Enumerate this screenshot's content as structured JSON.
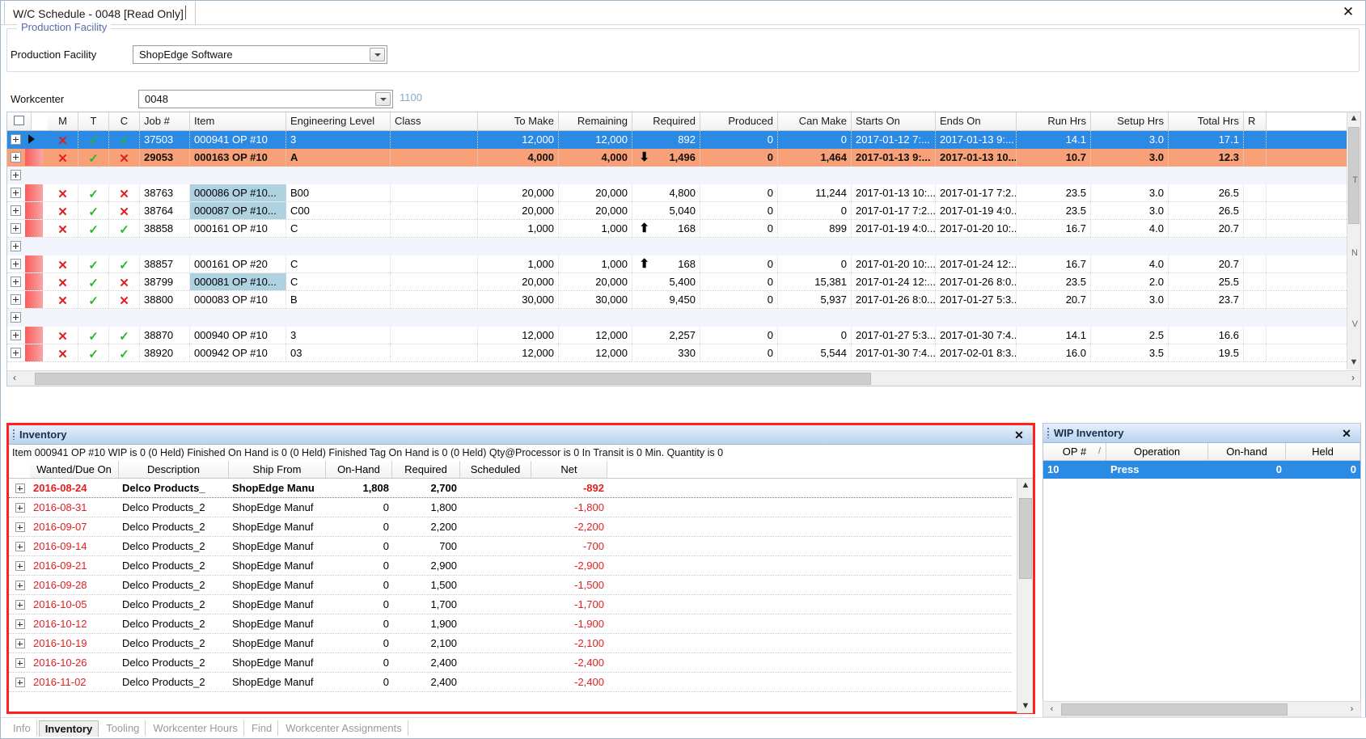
{
  "window": {
    "tab_title": "W/C Schedule - 0048 [Read Only]",
    "close_label": "✕"
  },
  "facility_group": {
    "legend": "Production Facility",
    "facility_label": "Production Facility",
    "facility_value": "ShopEdge Software",
    "workcenter_label": "Workcenter",
    "workcenter_value": "0048",
    "workcenter_code": "1100"
  },
  "schedule_grid": {
    "columns": [
      "M",
      "T",
      "C",
      "Job #",
      "Item",
      "Engineering Level",
      "Class",
      "To Make",
      "Remaining",
      "Required",
      "Produced",
      "Can Make",
      "Starts On",
      "Ends On",
      "Run Hrs",
      "Setup Hrs",
      "Total Hrs",
      "R"
    ],
    "rows": [
      {
        "state": "selected",
        "m": "✕",
        "t": "✓",
        "c": "✓",
        "job": "37503",
        "item": "000941 OP #10",
        "eng": "3",
        "class": "",
        "to_make": "12,000",
        "remaining": "12,000",
        "arrow": "",
        "required": "892",
        "produced": "0",
        "can_make": "0",
        "starts_on": "2017-01-12 7:...",
        "ends_on": "2017-01-13 9:...",
        "run_hrs": "14.1",
        "setup_hrs": "3.0",
        "total_hrs": "17.1"
      },
      {
        "state": "warn",
        "m": "✕",
        "t": "✓",
        "c": "✕",
        "job": "29053",
        "item": "000163 OP #10",
        "eng": "A",
        "class": "",
        "to_make": "4,000",
        "remaining": "4,000",
        "arrow": "down",
        "required": "1,496",
        "produced": "0",
        "can_make": "1,464",
        "starts_on": "2017-01-13 9:...",
        "ends_on": "2017-01-13 10...",
        "run_hrs": "10.7",
        "setup_hrs": "3.0",
        "total_hrs": "12.3"
      },
      {
        "state": "group"
      },
      {
        "state": "plain",
        "m": "✕",
        "t": "✓",
        "c": "✕",
        "job": "38763",
        "item": "000086 OP #10...",
        "item_hl": true,
        "eng": "B00",
        "class": "",
        "to_make": "20,000",
        "remaining": "20,000",
        "arrow": "",
        "required": "4,800",
        "produced": "0",
        "can_make": "11,244",
        "starts_on": "2017-01-13 10:...",
        "ends_on": "2017-01-17 7:2...",
        "run_hrs": "23.5",
        "setup_hrs": "3.0",
        "total_hrs": "26.5"
      },
      {
        "state": "plain",
        "m": "✕",
        "t": "✓",
        "c": "✕",
        "job": "38764",
        "item": "000087 OP #10...",
        "item_hl": true,
        "eng": "C00",
        "class": "",
        "to_make": "20,000",
        "remaining": "20,000",
        "arrow": "",
        "required": "5,040",
        "produced": "0",
        "can_make": "0",
        "starts_on": "2017-01-17 7:2...",
        "ends_on": "2017-01-19 4:0...",
        "run_hrs": "23.5",
        "setup_hrs": "3.0",
        "total_hrs": "26.5"
      },
      {
        "state": "plain",
        "m": "✕",
        "t": "✓",
        "c": "✓",
        "job": "38858",
        "item": "000161 OP #10",
        "eng": "C",
        "class": "",
        "to_make": "1,000",
        "remaining": "1,000",
        "arrow": "up",
        "required": "168",
        "produced": "0",
        "can_make": "899",
        "starts_on": "2017-01-19 4:0...",
        "ends_on": "2017-01-20 10:...",
        "run_hrs": "16.7",
        "setup_hrs": "4.0",
        "total_hrs": "20.7"
      },
      {
        "state": "group"
      },
      {
        "state": "plain",
        "m": "✕",
        "t": "✓",
        "c": "✓",
        "job": "38857",
        "item": "000161 OP #20",
        "eng": "C",
        "class": "",
        "to_make": "1,000",
        "remaining": "1,000",
        "arrow": "up",
        "required": "168",
        "produced": "0",
        "can_make": "0",
        "starts_on": "2017-01-20 10:...",
        "ends_on": "2017-01-24 12:...",
        "run_hrs": "16.7",
        "setup_hrs": "4.0",
        "total_hrs": "20.7"
      },
      {
        "state": "plain",
        "m": "✕",
        "t": "✓",
        "c": "✕",
        "job": "38799",
        "item": "000081 OP #10...",
        "item_hl": true,
        "eng": "C",
        "class": "",
        "to_make": "20,000",
        "remaining": "20,000",
        "arrow": "",
        "required": "5,400",
        "produced": "0",
        "can_make": "15,381",
        "starts_on": "2017-01-24 12:...",
        "ends_on": "2017-01-26 8:0...",
        "run_hrs": "23.5",
        "setup_hrs": "2.0",
        "total_hrs": "25.5"
      },
      {
        "state": "plain",
        "m": "✕",
        "t": "✓",
        "c": "✕",
        "job": "38800",
        "item": "000083 OP #10",
        "eng": "B",
        "class": "",
        "to_make": "30,000",
        "remaining": "30,000",
        "arrow": "",
        "required": "9,450",
        "produced": "0",
        "can_make": "5,937",
        "starts_on": "2017-01-26 8:0...",
        "ends_on": "2017-01-27 5:3...",
        "run_hrs": "20.7",
        "setup_hrs": "3.0",
        "total_hrs": "23.7"
      },
      {
        "state": "group"
      },
      {
        "state": "plain",
        "m": "✕",
        "t": "✓",
        "c": "✓",
        "job": "38870",
        "item": "000940 OP #10",
        "eng": "3",
        "class": "",
        "to_make": "12,000",
        "remaining": "12,000",
        "arrow": "",
        "required": "2,257",
        "produced": "0",
        "can_make": "0",
        "starts_on": "2017-01-27 5:3...",
        "ends_on": "2017-01-30 7:4...",
        "run_hrs": "14.1",
        "setup_hrs": "2.5",
        "total_hrs": "16.6"
      },
      {
        "state": "plain",
        "m": "✕",
        "t": "✓",
        "c": "✓",
        "job": "38920",
        "item": "000942 OP #10",
        "eng": "03",
        "class": "",
        "to_make": "12,000",
        "remaining": "12,000",
        "arrow": "",
        "required": "330",
        "produced": "0",
        "can_make": "5,544",
        "starts_on": "2017-01-30 7:4...",
        "ends_on": "2017-02-01 8:3...",
        "run_hrs": "16.0",
        "setup_hrs": "3.5",
        "total_hrs": "19.5"
      }
    ],
    "side_letters": [
      "T",
      "N",
      "V"
    ],
    "scroll_left_label": "‹",
    "scroll_right_label": "›",
    "scroll_up_label": "▲",
    "scroll_down_label": "▼"
  },
  "inventory_panel": {
    "title": "Inventory",
    "close_label": "✕",
    "status_line": "Item 000941 OP #10  WIP is 0 (0 Held)  Finished On Hand is 0 (0 Held)  Finished Tag On Hand is 0  (0 Held)  Qty@Processor is 0 In Transit is 0 Min. Quantity is 0",
    "columns": [
      "Wanted/Due On",
      "Description",
      "Ship From",
      "On-Hand",
      "Required",
      "Scheduled",
      "Net"
    ],
    "rows": [
      {
        "date": "2016-08-24",
        "description": "Delco Products_",
        "ship_from": "ShopEdge Manu",
        "on_hand": "1,808",
        "required": "2,700",
        "scheduled": "",
        "net": "-892",
        "bold": true
      },
      {
        "date": "2016-08-31",
        "description": "Delco Products_2",
        "ship_from": "ShopEdge Manuf",
        "on_hand": "0",
        "required": "1,800",
        "scheduled": "",
        "net": "-1,800",
        "bold": false
      },
      {
        "date": "2016-09-07",
        "description": "Delco Products_2",
        "ship_from": "ShopEdge Manuf",
        "on_hand": "0",
        "required": "2,200",
        "scheduled": "",
        "net": "-2,200",
        "bold": false
      },
      {
        "date": "2016-09-14",
        "description": "Delco Products_2",
        "ship_from": "ShopEdge Manuf",
        "on_hand": "0",
        "required": "700",
        "scheduled": "",
        "net": "-700",
        "bold": false
      },
      {
        "date": "2016-09-21",
        "description": "Delco Products_2",
        "ship_from": "ShopEdge Manuf",
        "on_hand": "0",
        "required": "2,900",
        "scheduled": "",
        "net": "-2,900",
        "bold": false
      },
      {
        "date": "2016-09-28",
        "description": "Delco Products_2",
        "ship_from": "ShopEdge Manuf",
        "on_hand": "0",
        "required": "1,500",
        "scheduled": "",
        "net": "-1,500",
        "bold": false
      },
      {
        "date": "2016-10-05",
        "description": "Delco Products_2",
        "ship_from": "ShopEdge Manuf",
        "on_hand": "0",
        "required": "1,700",
        "scheduled": "",
        "net": "-1,700",
        "bold": false
      },
      {
        "date": "2016-10-12",
        "description": "Delco Products_2",
        "ship_from": "ShopEdge Manuf",
        "on_hand": "0",
        "required": "1,900",
        "scheduled": "",
        "net": "-1,900",
        "bold": false
      },
      {
        "date": "2016-10-19",
        "description": "Delco Products_2",
        "ship_from": "ShopEdge Manuf",
        "on_hand": "0",
        "required": "2,100",
        "scheduled": "",
        "net": "-2,100",
        "bold": false
      },
      {
        "date": "2016-10-26",
        "description": "Delco Products_2",
        "ship_from": "ShopEdge Manuf",
        "on_hand": "0",
        "required": "2,400",
        "scheduled": "",
        "net": "-2,400",
        "bold": false
      },
      {
        "date": "2016-11-02",
        "description": "Delco Products_2",
        "ship_from": "ShopEdge Manuf",
        "on_hand": "0",
        "required": "2,400",
        "scheduled": "",
        "net": "-2,400",
        "bold": false
      }
    ],
    "scroll_up_label": "▲",
    "scroll_down_label": "▼"
  },
  "wip_panel": {
    "title": "WIP Inventory",
    "close_label": "✕",
    "columns": [
      "OP #",
      "Operation",
      "On-hand",
      "Held"
    ],
    "sort_indicator": "/",
    "rows": [
      {
        "op": "10",
        "operation": "Press",
        "on_hand": "0",
        "held": "0"
      }
    ],
    "scroll_left_label": "‹",
    "scroll_right_label": "›"
  },
  "bottom_tabs": {
    "items": [
      "Info",
      "Inventory",
      "Tooling",
      "Workcenter Hours",
      "Find",
      "Workcenter Assignments"
    ],
    "active": "Inventory"
  },
  "colors": {
    "selection_blue": "#2a8ae4",
    "warn_orange": "#f8a077",
    "alert_red": "#ff2020",
    "link_blue": "#4f6fa8",
    "check_green": "#2ab82a",
    "x_red": "#e02020"
  }
}
